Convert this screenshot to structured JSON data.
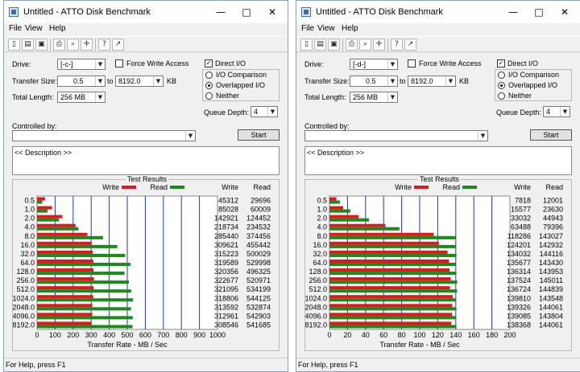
{
  "windows": [
    {
      "title": "Untitled - ATTO Disk Benchmark",
      "menu": [
        "File",
        "View",
        "Help"
      ],
      "drive": {
        "label": "Drive:",
        "value": "[-c-]"
      },
      "force_write_access": {
        "label": "Force Write Access",
        "checked": false
      },
      "direct_io": {
        "label": "Direct I/O",
        "checked": true
      },
      "transfer_size": {
        "label": "Transfer Size:",
        "from": "0.5",
        "to_label": "to",
        "to": "8192.0",
        "unit": "KB"
      },
      "total_length": {
        "label": "Total Length:",
        "value": "256 MB"
      },
      "io_mode": {
        "options": [
          "I/O Comparison",
          "Overlapped I/O",
          "Neither"
        ],
        "selected": "Overlapped I/O"
      },
      "queue_depth": {
        "label": "Queue Depth:",
        "value": "4"
      },
      "controlled_by": {
        "label": "Controlled by:",
        "value": ""
      },
      "start_label": "Start",
      "description": "<< Description >>",
      "status": "For Help, press F1",
      "chart_data": {
        "type": "bar",
        "orientation": "horizontal",
        "title": "Test Results",
        "categories": [
          "0.5",
          "1.0",
          "2.0",
          "4.0",
          "8.0",
          "16.0",
          "32.0",
          "64.0",
          "128.0",
          "256.0",
          "512.0",
          "1024.0",
          "2048.0",
          "4096.0",
          "8192.0"
        ],
        "series": [
          {
            "name": "Write",
            "color": "#e8141c",
            "values": [
              45312,
              85028,
              142921,
              218734,
              285440,
              309621,
              315223,
              319589,
              320356,
              322677,
              321095,
              318806,
              313592,
              312961,
              308546
            ]
          },
          {
            "name": "Read",
            "color": "#1a8a1a",
            "values": [
              29696,
              60009,
              124452,
              234532,
              374456,
              455442,
              500029,
              529998,
              496325,
              520971,
              534199,
              544125,
              532874,
              542903,
              541685
            ]
          }
        ],
        "column_headers": [
          "Write",
          "Read"
        ],
        "xlabel": "Transfer Rate - MB / Sec",
        "xticks": [
          "0",
          "100",
          "200",
          "300",
          "400",
          "500",
          "600",
          "700",
          "800",
          "900",
          "1000"
        ],
        "xlim": [
          0,
          1000
        ],
        "grid": true,
        "legend": "top"
      }
    },
    {
      "title": "Untitled - ATTO Disk Benchmark",
      "menu": [
        "File",
        "View",
        "Help"
      ],
      "drive": {
        "label": "Drive:",
        "value": "[-d-]"
      },
      "force_write_access": {
        "label": "Force Write Access",
        "checked": false
      },
      "direct_io": {
        "label": "Direct I/O",
        "checked": true
      },
      "transfer_size": {
        "label": "Transfer Size:",
        "from": "0.5",
        "to_label": "to",
        "to": "8192.0",
        "unit": "KB"
      },
      "total_length": {
        "label": "Total Length:",
        "value": "256 MB"
      },
      "io_mode": {
        "options": [
          "I/O Comparison",
          "Overlapped I/O",
          "Neither"
        ],
        "selected": "Overlapped I/O"
      },
      "queue_depth": {
        "label": "Queue Depth:",
        "value": "4"
      },
      "controlled_by": {
        "label": "Controlled by:",
        "value": ""
      },
      "start_label": "Start",
      "description": "<< Description >>",
      "status": "For Help, press F1",
      "chart_data": {
        "type": "bar",
        "orientation": "horizontal",
        "title": "Test Results",
        "categories": [
          "0.5",
          "1.0",
          "2.0",
          "4.0",
          "8.0",
          "16.0",
          "32.0",
          "64.0",
          "128.0",
          "256.0",
          "512.0",
          "1024.0",
          "2048.0",
          "4096.0",
          "8192.0"
        ],
        "series": [
          {
            "name": "Write",
            "color": "#e8141c",
            "values": [
              7818,
              15577,
              33032,
              63488,
              118286,
              124201,
              134032,
              135677,
              136314,
              137524,
              136724,
              139810,
              139326,
              139085,
              138368
            ]
          },
          {
            "name": "Read",
            "color": "#1a8a1a",
            "values": [
              12001,
              23630,
              44943,
              79396,
              143027,
              142932,
              144116,
              143430,
              143953,
              145011,
              144839,
              143548,
              144061,
              143804,
              144061
            ]
          }
        ],
        "column_headers": [
          "Write",
          "Read"
        ],
        "xlabel": "Transfer Rate - MB / Sec",
        "xticks": [
          "0",
          "20",
          "40",
          "60",
          "80",
          "100",
          "120",
          "140",
          "160",
          "180",
          "200"
        ],
        "xlim": [
          0,
          200
        ],
        "grid": true,
        "legend": "top"
      }
    }
  ]
}
